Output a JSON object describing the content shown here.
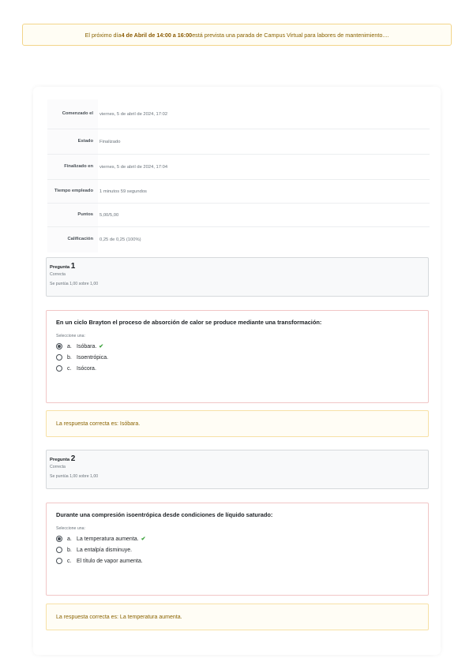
{
  "notice": {
    "prefix": "El próximo día ",
    "highlight": "4 de Abril de 14:00 a 16:00",
    "suffix": " está prevista una parada de Campus Virtual para labores de mantenimiento...."
  },
  "summary": [
    {
      "key": "Comenzado el",
      "value": "viernes, 5 de abril de 2024, 17:02"
    },
    {
      "key": "Estado",
      "value": "Finalizado"
    },
    {
      "key": "Finalizado en",
      "value": "viernes, 5 de abril de 2024, 17:04"
    },
    {
      "key": "Tiempo empleado",
      "value": "1 minutos 59 segundos"
    },
    {
      "key": "Puntos",
      "value": "5,00/5,00"
    },
    {
      "key": "Calificación",
      "value": "0,25 de 0,25 (100%)"
    }
  ],
  "questions": [
    {
      "label": "Pregunta ",
      "number": "1",
      "state": "Correcta",
      "grade": "Se puntúa 1,00 sobre 1,00",
      "text": "En un ciclo Brayton el proceso de absorción de calor se produce mediante una transformación:",
      "prompt": "Seleccione una:",
      "options": [
        {
          "letter": "a.",
          "text": "Isóbara.",
          "selected": true,
          "correct": true
        },
        {
          "letter": "b.",
          "text": "Isoentrópica.",
          "selected": false,
          "correct": false
        },
        {
          "letter": "c.",
          "text": "Isócora.",
          "selected": false,
          "correct": false
        }
      ],
      "feedback": "La respuesta correcta es: Isóbara."
    },
    {
      "label": "Pregunta ",
      "number": "2",
      "state": "Correcta",
      "grade": "Se puntúa 1,00 sobre 1,00",
      "text": "Durante una compresión isoentrópica desde condiciones de líquido saturado:",
      "prompt": "Seleccione una:",
      "options": [
        {
          "letter": "a.",
          "text": "La temperatura aumenta.",
          "selected": true,
          "correct": true
        },
        {
          "letter": "b.",
          "text": "La entalpía disminuye.",
          "selected": false,
          "correct": false
        },
        {
          "letter": "c.",
          "text": "El título de vapor aumenta.",
          "selected": false,
          "correct": false
        }
      ],
      "feedback": "La respuesta correcta es: La temperatura aumenta."
    }
  ],
  "check_icon": "check-icon",
  "colors": {
    "notice": "#8a6300",
    "correct": "#3ea33e",
    "incorrect_border": "#f1c6c6"
  }
}
